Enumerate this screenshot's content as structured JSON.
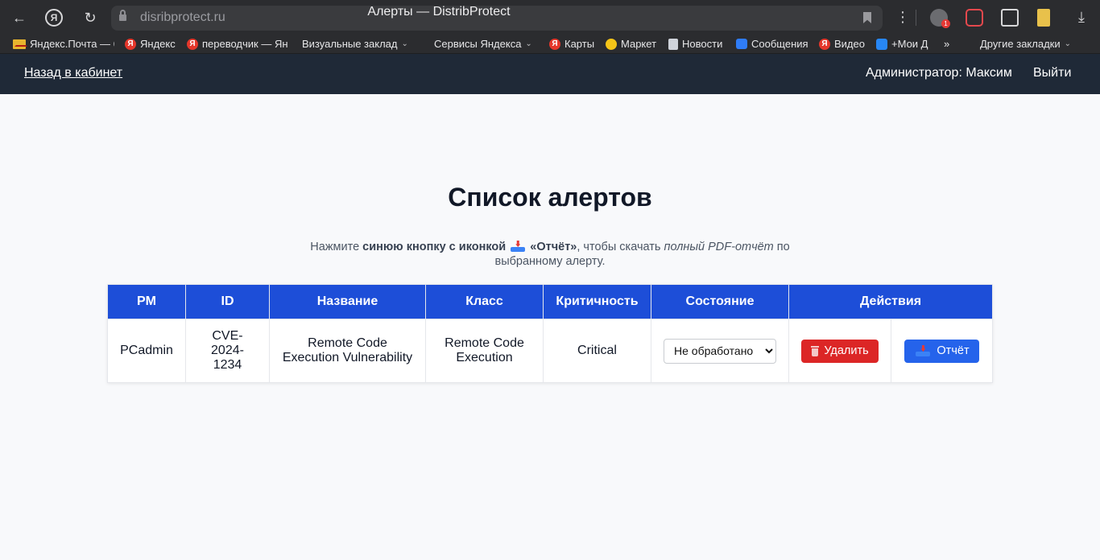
{
  "browser": {
    "url": "disribprotect.ru",
    "tab_title": "Алерты — DistribProtect",
    "bookmarks": [
      {
        "label": "Яндекс.Почта — б",
        "icon": "mail-icon"
      },
      {
        "label": "Яндекс",
        "icon": "yandex-icon"
      },
      {
        "label": "переводчик — Ян",
        "icon": "yandex-icon"
      },
      {
        "label": "Визуальные заклад",
        "icon": "folder-icon"
      },
      {
        "label": "Сервисы Яндекса",
        "icon": "folder-icon"
      },
      {
        "label": "Карты",
        "icon": "yandex-icon"
      },
      {
        "label": "Маркет",
        "icon": "market-icon"
      },
      {
        "label": "Новости",
        "icon": "news-icon"
      },
      {
        "label": "Сообщения",
        "icon": "messages-icon"
      },
      {
        "label": "Видео",
        "icon": "yandex-icon"
      },
      {
        "label": "+Мои Д",
        "icon": "vk-icon"
      }
    ],
    "more_bookmarks": "»",
    "other_bookmarks": "Другие закладки",
    "ya_letter": "Я",
    "badge_count": "1"
  },
  "header": {
    "back_link": "Назад в кабинет",
    "admin": "Администратор: Максим",
    "logout": "Выйти"
  },
  "main": {
    "title": "Список алертов",
    "hint": {
      "part1": "Нажмите ",
      "bold1": "синюю кнопку с иконкой",
      "bold2": "«Отчёт»",
      "part2": ", чтобы скачать ",
      "italic": "полный PDF-отчёт",
      "part3": " по выбранному алерту."
    }
  },
  "table": {
    "headers": [
      "PM",
      "ID",
      "Название",
      "Класс",
      "Критичность",
      "Состояние",
      "Действия"
    ],
    "rows": [
      {
        "pm": "PCadmin",
        "id": "CVE-2024-1234",
        "name": "Remote Code Execution Vulnerability",
        "class": "Remote Code Execution",
        "severity": "Critical",
        "state": "Не обработано",
        "delete_label": "Удалить",
        "report_label": "Отчёт"
      }
    ]
  },
  "colors": {
    "header_bg": "#1f2937",
    "table_header_bg": "#1d4ed8",
    "delete_btn": "#dc2626",
    "report_btn": "#2563eb"
  }
}
